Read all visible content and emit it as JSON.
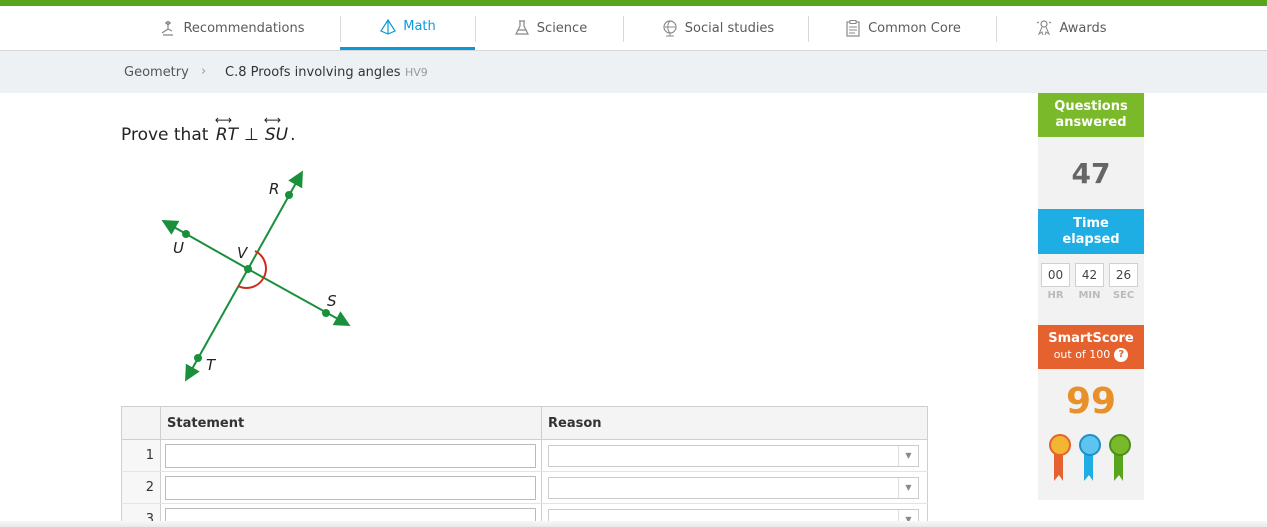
{
  "nav": {
    "items": [
      {
        "label": "Recommendations",
        "icon": "recommendations-icon"
      },
      {
        "label": "Math",
        "icon": "pyramid-icon",
        "active": true
      },
      {
        "label": "Science",
        "icon": "flask-icon"
      },
      {
        "label": "Social studies",
        "icon": "globe-icon"
      },
      {
        "label": "Common Core",
        "icon": "clipboard-icon"
      },
      {
        "label": "Awards",
        "icon": "awards-icon"
      }
    ]
  },
  "breadcrumb": {
    "subject": "Geometry",
    "skill": "C.8 Proofs involving angles",
    "code": "HV9"
  },
  "question": {
    "prefix": "Prove that",
    "line1": "RT",
    "relation": "⊥",
    "line2": "SU",
    "suffix": ".",
    "figure_labels": {
      "R": "R",
      "U": "U",
      "V": "V",
      "S": "S",
      "T": "T"
    }
  },
  "proof_table": {
    "headers": {
      "statement": "Statement",
      "reason": "Reason"
    },
    "rows": [
      {
        "num": "1",
        "statement": "",
        "reason": ""
      },
      {
        "num": "2",
        "statement": "",
        "reason": ""
      },
      {
        "num": "3",
        "statement": "",
        "reason": ""
      }
    ]
  },
  "sidebar": {
    "questions_answered": {
      "label": "Questions answered",
      "value": "47"
    },
    "time_elapsed": {
      "label": "Time elapsed",
      "hr": "00",
      "min": "42",
      "sec": "26",
      "hr_label": "HR",
      "min_label": "MIN",
      "sec_label": "SEC"
    },
    "smartscore": {
      "label": "SmartScore",
      "sub": "out of 100",
      "help": "?",
      "value": "99"
    }
  },
  "colors": {
    "brand_green": "#56a51c",
    "active_blue": "#0a9ad7",
    "questions_green": "#7ab929",
    "time_blue": "#1eaee3",
    "smartscore_orange": "#e5622e",
    "score_text": "#e8902a",
    "figure_green": "#1a8f3c",
    "angle_red": "#d02a1e"
  }
}
